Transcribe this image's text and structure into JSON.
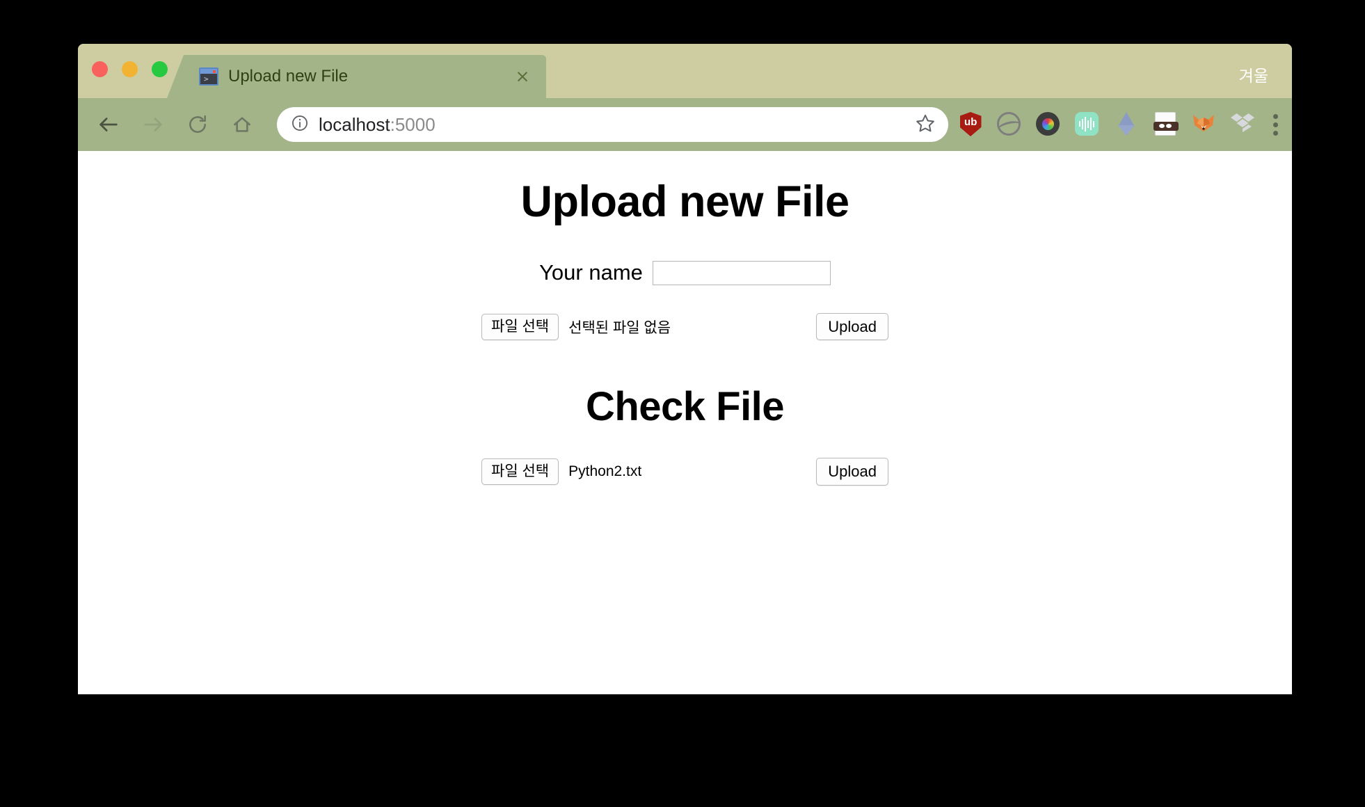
{
  "window": {
    "traffic_lights": [
      {
        "name": "close",
        "color": "#f9615c"
      },
      {
        "name": "minimize",
        "color": "#f2b332"
      },
      {
        "name": "zoom",
        "color": "#26c940"
      }
    ],
    "theme": {
      "tab_strip_bg": "#cdcda1",
      "toolbar_bg": "#a3b489",
      "active_tab_bg": "#a3b489",
      "tab_text": "#2f4012",
      "page_bg": "#ffffff"
    }
  },
  "tabs": [
    {
      "title": "Upload new File",
      "favicon": "terminal-icon",
      "close_label": "×",
      "active": true
    }
  ],
  "profile": {
    "name": "겨울"
  },
  "toolbar": {
    "back_icon": "back-arrow-icon",
    "forward_icon": "forward-arrow-icon",
    "reload_icon": "reload-icon",
    "home_icon": "home-icon",
    "info_icon": "info-circle-icon",
    "bookmark_icon": "star-icon",
    "menu_icon": "three-dots-icon",
    "url": {
      "host": "localhost",
      "port": ":5000",
      "full": "localhost:5000"
    },
    "extensions": [
      {
        "name": "ublock-origin-icon",
        "label": "ub",
        "color": "#a81b13"
      },
      {
        "name": "wave-circle-icon",
        "color": "#7e7e7e"
      },
      {
        "name": "camera-lens-icon",
        "color": "#3c3c3c"
      },
      {
        "name": "audio-waveform-icon",
        "color": "#8fe3c4"
      },
      {
        "name": "ethereum-icon",
        "color": "#8b9cc4"
      },
      {
        "name": "masked-document-icon",
        "color": "#4a3229"
      },
      {
        "name": "fox-icon",
        "color": "#e8833a"
      },
      {
        "name": "dropbox-icon",
        "color": "#d7d9dc"
      }
    ]
  },
  "page": {
    "heading_upload": "Upload new File",
    "heading_check": "Check File",
    "name_field": {
      "label": "Your name",
      "value": "",
      "placeholder": ""
    },
    "upload_form": {
      "choose_label": "파일 선택",
      "status": "선택된 파일 없음",
      "submit_label": "Upload"
    },
    "check_form": {
      "choose_label": "파일 선택",
      "status": "Python2.txt",
      "submit_label": "Upload"
    }
  }
}
